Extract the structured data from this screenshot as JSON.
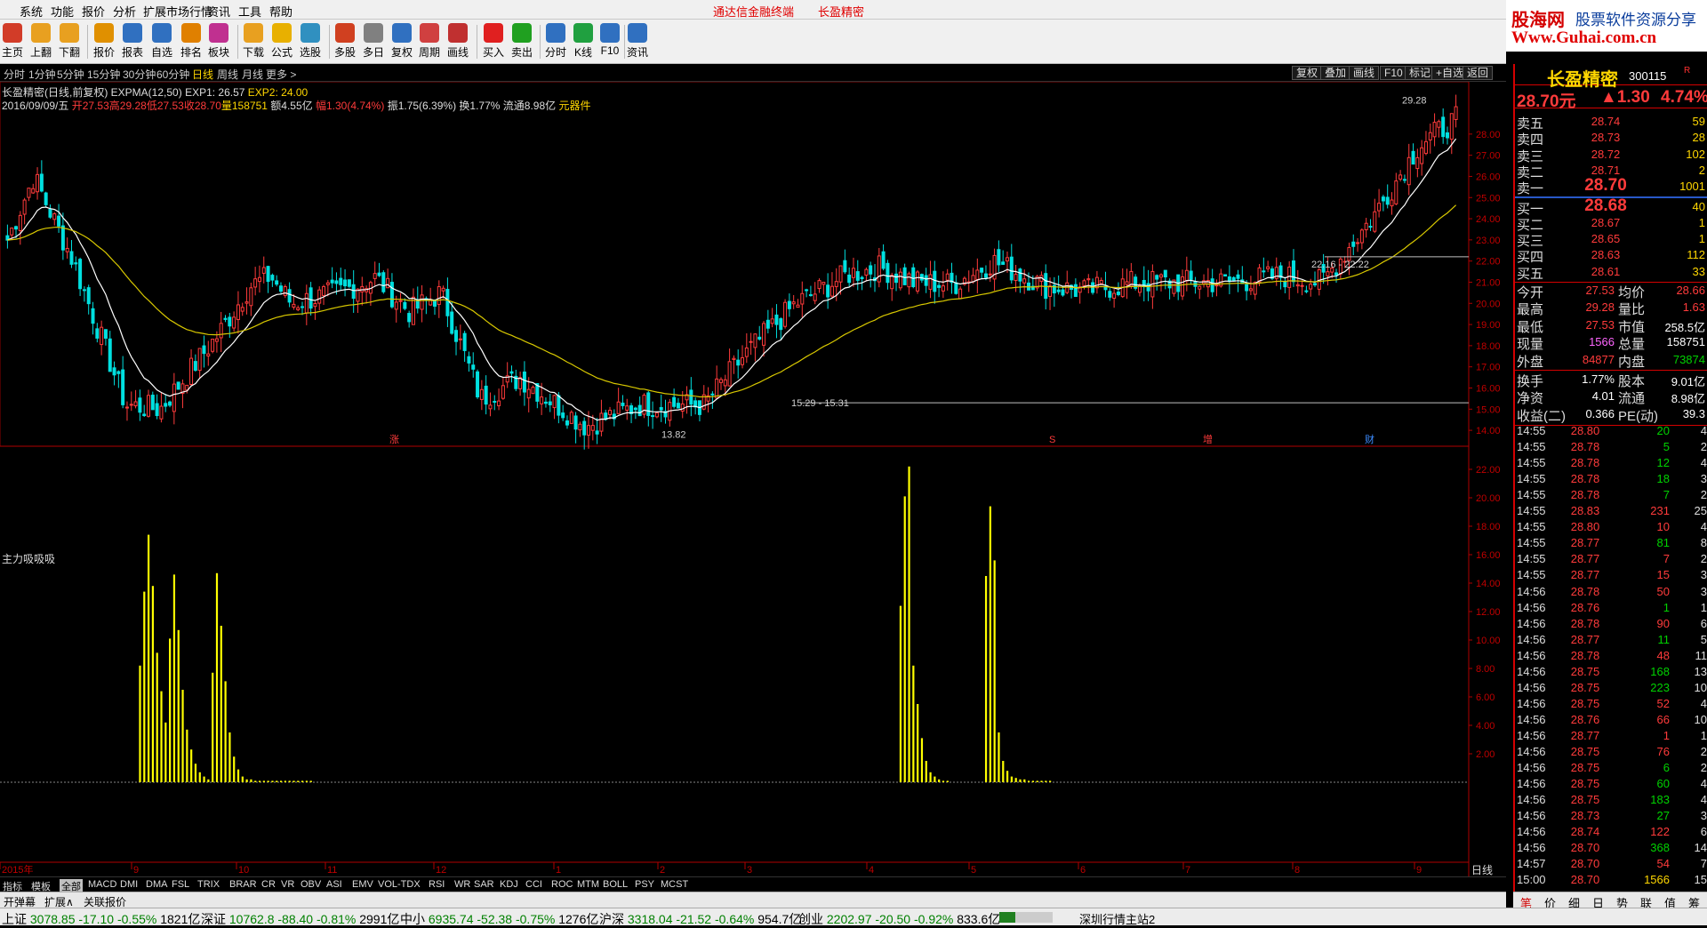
{
  "menu": {
    "items": [
      "系统",
      "功能",
      "报价",
      "分析",
      "扩展市场行情",
      "资讯",
      "工具",
      "帮助"
    ],
    "notice1": "通达信金融终端",
    "notice2": "长盈精密"
  },
  "logo": {
    "text1": "股海网",
    "text2": "股票软件资源分享",
    "text3": "Www.Guhai.com.cn"
  },
  "toolbar": [
    {
      "label": "主页",
      "icon": "home-icon",
      "color": "#d23c28"
    },
    {
      "label": "上翻",
      "icon": "up-arrow-icon",
      "color": "#e8a020"
    },
    {
      "label": "下翻",
      "icon": "down-arrow-icon",
      "color": "#e8a020"
    },
    {
      "label": "报价",
      "icon": "yen-icon",
      "color": "#e09000"
    },
    {
      "label": "报表",
      "icon": "report-icon",
      "color": "#3070c0"
    },
    {
      "label": "自选",
      "icon": "f6-icon",
      "color": "#3070c0"
    },
    {
      "label": "排名",
      "icon": "rank-icon",
      "color": "#e08000"
    },
    {
      "label": "板块",
      "icon": "sector-icon",
      "color": "#c03090"
    },
    {
      "label": "下载",
      "icon": "download-icon",
      "color": "#e8a020"
    },
    {
      "label": "公式",
      "icon": "formula-icon",
      "color": "#e8b000"
    },
    {
      "label": "选股",
      "icon": "select-icon",
      "color": "#3090c0"
    },
    {
      "label": "多股",
      "icon": "multi-stock-icon",
      "color": "#d04020"
    },
    {
      "label": "多日",
      "icon": "multi-day-icon",
      "color": "#808080"
    },
    {
      "label": "复权",
      "icon": "restore-icon",
      "color": "#3070c0"
    },
    {
      "label": "周期",
      "icon": "f8-icon",
      "color": "#d04040"
    },
    {
      "label": "画线",
      "icon": "draw-icon",
      "color": "#c03030"
    },
    {
      "label": "买入",
      "icon": "buy-icon",
      "color": "#e02020"
    },
    {
      "label": "卖出",
      "icon": "sell-icon",
      "color": "#20a020"
    },
    {
      "label": "分时",
      "icon": "intraday-icon",
      "color": "#3070c0"
    },
    {
      "label": "K线",
      "icon": "kline-icon",
      "color": "#20a040"
    },
    {
      "label": "F10",
      "icon": "f10-icon",
      "color": "#3070c0"
    },
    {
      "label": "资讯",
      "icon": "news-icon",
      "color": "#3070c0"
    }
  ],
  "periods": [
    "分时",
    "1分钟",
    "5分钟",
    "15分钟",
    "30分钟",
    "60分钟",
    "日线",
    "周线",
    "月线",
    "更多 >"
  ],
  "active_period": "日线",
  "right_buttons": [
    "复权",
    "叠加",
    "画线",
    "F10",
    "标记",
    "+自选",
    "返回"
  ],
  "info": {
    "name_line": "长盈精密(日线,前复权)",
    "expma_label": "EXPMA(12,50)",
    "exp1": "EXP1: 26.57",
    "exp2": "EXP2: 24.00",
    "date": "2016/09/09/五",
    "open": "开27.53",
    "high": "高29.28",
    "low": "低27.53",
    "close": "收28.70",
    "vol": "量158751",
    "amount": "额4.55亿",
    "rise": "幅1.30(4.74%)",
    "amp": "振1.75(6.39%)",
    "turnover": "换1.77%",
    "float": "流通8.98亿",
    "yuanqijian": "元器件"
  },
  "indicator": {
    "name": "主力吸吸吸"
  },
  "indicator_tabs": [
    "指标",
    "模板",
    "全部",
    "MACD",
    "DMI",
    "DMA",
    "FSL",
    "TRIX",
    "BRAR",
    "CR",
    "VR",
    "OBV",
    "ASI",
    "EMV",
    "VOL-TDX",
    "RSI",
    "WR",
    "SAR",
    "KDJ",
    "CCI",
    "ROC",
    "MTM",
    "BOLL",
    "PSY",
    "MCST"
  ],
  "bottom_tabs": [
    "开弹幕",
    "扩展∧",
    "关联报价"
  ],
  "day_label": "日线",
  "chart_data": [
    {
      "type": "candlestick",
      "title": "长盈精密(日线,前复权)",
      "ylim": [
        13.5,
        29.8
      ],
      "yticks": [
        "28.00",
        "27.00",
        "26.00",
        "25.00",
        "24.00",
        "23.00",
        "22.00",
        "21.00",
        "20.00",
        "19.00",
        "18.00",
        "17.00",
        "16.00",
        "15.00",
        "14.00"
      ],
      "xlabels": [
        "2015年",
        "9",
        "10",
        "11",
        "12",
        "1",
        "2",
        "3",
        "4",
        "5",
        "6",
        "7",
        "8",
        "9"
      ],
      "annotations": [
        "29.28",
        "13.82",
        "15.29 - 15.31",
        "22.16 - 22.22"
      ],
      "markers": [
        "涨",
        "S",
        "增",
        "财"
      ],
      "series": [
        {
          "name": "EXP1"
        },
        {
          "name": "EXP2"
        }
      ]
    },
    {
      "type": "bar",
      "title": "主力吸吸吸",
      "ylim": [
        0,
        22.5
      ],
      "yticks": [
        "22.00",
        "20.00",
        "18.00",
        "16.00",
        "14.00",
        "12.00",
        "10.00",
        "8.00",
        "6.00",
        "4.00",
        "2.00"
      ],
      "values": [
        0,
        0,
        0,
        0,
        0,
        0,
        0,
        0,
        0,
        0,
        0,
        0,
        0,
        0,
        0,
        0,
        0,
        0,
        0,
        0,
        0,
        0,
        0,
        0,
        0,
        0,
        0,
        0,
        0,
        0,
        0,
        8.2,
        13.4,
        17.4,
        13.8,
        9.1,
        6.4,
        4.2,
        10.1,
        14.6,
        10.7,
        6.5,
        3.7,
        2.3,
        1.3,
        0.7,
        0.4,
        0.2,
        7.7,
        14.7,
        11.0,
        7.1,
        3.5,
        1.8,
        0.9,
        0.4,
        0.2,
        0.2,
        0.1,
        0.1,
        0.1,
        0.1,
        0.1,
        0.1,
        0.1,
        0.1,
        0.1,
        0.1,
        0.1,
        0.1,
        0.1,
        0.1,
        0,
        0,
        0,
        0,
        0,
        0,
        0,
        0,
        0,
        0,
        0,
        0,
        0,
        0,
        0,
        0,
        0,
        0,
        0,
        0,
        0,
        0,
        0,
        0,
        0,
        0,
        0,
        0,
        0,
        0,
        0,
        0,
        0,
        0,
        0,
        0,
        0,
        0,
        0,
        0,
        0,
        0,
        0,
        0,
        0,
        0,
        0,
        0,
        0,
        0,
        0,
        0,
        0,
        0,
        0,
        0,
        0,
        0,
        0,
        0,
        0,
        0,
        0,
        0,
        0,
        0,
        0,
        0,
        0,
        0,
        0,
        0,
        0,
        0,
        0,
        0,
        0,
        0,
        0,
        0,
        0,
        0,
        0,
        0,
        0,
        0,
        0,
        0,
        0,
        0,
        0,
        0,
        0,
        0,
        0,
        0,
        0,
        0,
        0,
        0,
        0,
        0,
        0,
        0,
        0,
        0,
        0,
        0,
        0,
        0,
        0,
        0,
        0,
        0,
        0,
        0,
        0,
        0,
        0,
        0,
        0,
        0,
        0,
        0,
        0,
        0,
        0,
        0,
        0,
        0,
        0,
        0,
        0,
        0,
        0,
        0,
        0,
        12.4,
        20.1,
        22.2,
        8.2,
        5.5,
        3.1,
        1.5,
        0.7,
        0.4,
        0.2,
        0.1,
        0.1,
        0,
        0,
        0,
        0,
        0,
        0,
        0,
        0,
        14.5,
        19.4,
        15.6,
        3.5,
        1.5,
        0.8,
        0.4,
        0.3,
        0.2,
        0.2,
        0.1,
        0.1,
        0.1,
        0.1,
        0.1,
        0.1,
        0,
        0,
        0,
        0,
        0,
        0,
        0,
        0,
        0,
        0,
        0,
        0,
        0,
        0,
        0,
        0,
        0,
        0,
        0,
        0,
        0,
        0,
        0,
        0,
        0,
        0,
        0,
        0,
        0,
        0,
        0,
        0,
        0,
        0,
        0,
        0,
        0,
        0,
        0,
        0,
        0,
        0,
        0,
        0,
        0,
        0,
        0,
        0,
        0,
        0,
        0,
        0,
        0,
        0,
        0,
        0,
        0,
        0,
        0,
        0,
        0,
        0,
        0,
        0,
        0,
        0,
        0,
        0,
        0,
        0,
        0,
        0,
        0,
        0,
        0,
        0,
        0,
        0,
        0,
        0,
        0,
        0,
        0,
        0,
        0,
        0,
        0,
        0,
        0,
        0,
        0,
        0,
        0,
        0,
        0,
        0,
        0,
        0,
        0,
        0,
        0,
        0,
        0,
        0,
        0,
        0,
        0,
        0,
        0,
        0,
        0,
        0,
        0,
        0,
        0,
        0,
        0,
        0,
        0,
        0,
        0,
        0,
        0,
        0,
        0,
        0,
        0
      ]
    }
  ],
  "right_panel": {
    "name": "长盈精密",
    "code": "300115",
    "rmark": "R",
    "price": "28.70元",
    "change": "▲1.30",
    "pct": "4.74%",
    "asks": [
      {
        "label": "卖五",
        "price": "28.74",
        "vol": "59"
      },
      {
        "label": "卖四",
        "price": "28.73",
        "vol": "28"
      },
      {
        "label": "卖三",
        "price": "28.72",
        "vol": "102"
      },
      {
        "label": "卖二",
        "price": "28.71",
        "vol": "2"
      },
      {
        "label": "卖一",
        "price": "28.70",
        "vol": "1001"
      }
    ],
    "bids": [
      {
        "label": "买一",
        "price": "28.68",
        "vol": "40"
      },
      {
        "label": "买二",
        "price": "28.67",
        "vol": "1"
      },
      {
        "label": "买三",
        "price": "28.65",
        "vol": "1"
      },
      {
        "label": "买四",
        "price": "28.63",
        "vol": "112"
      },
      {
        "label": "买五",
        "price": "28.61",
        "vol": "33"
      }
    ],
    "stats": [
      {
        "l1": "今开",
        "v1": "27.53",
        "c1": "#ff3b3b",
        "l2": "均价",
        "v2": "28.66",
        "c2": "#ff3b3b"
      },
      {
        "l1": "最高",
        "v1": "29.28",
        "c1": "#ff3b3b",
        "l2": "量比",
        "v2": "1.63",
        "c2": "#ff3b3b"
      },
      {
        "l1": "最低",
        "v1": "27.53",
        "c1": "#ff3b3b",
        "l2": "市值",
        "v2": "258.5亿",
        "c2": "#ffffff"
      },
      {
        "l1": "现量",
        "v1": "1566",
        "c1": "#ff66ff",
        "l2": "总量",
        "v2": "158751",
        "c2": "#ffffff"
      },
      {
        "l1": "外盘",
        "v1": "84877",
        "c1": "#ff3b3b",
        "l2": "内盘",
        "v2": "73874",
        "c2": "#00d200"
      },
      {
        "l1": "换手",
        "v1": "1.77%",
        "c1": "#ffffff",
        "l2": "股本",
        "v2": "9.01亿",
        "c2": "#ffffff"
      },
      {
        "l1": "净资",
        "v1": "4.01",
        "c1": "#ffffff",
        "l2": "流通",
        "v2": "8.98亿",
        "c2": "#ffffff"
      },
      {
        "l1": "收益(二)",
        "v1": "0.366",
        "c1": "#ffffff",
        "l2": "PE(动)",
        "v2": "39.3",
        "c2": "#ffffff"
      }
    ],
    "ticks": [
      {
        "t": "14:55",
        "p": "28.80",
        "v": "20",
        "vc": "#00d200",
        "n": "4"
      },
      {
        "t": "14:55",
        "p": "28.78",
        "v": "5",
        "vc": "#00d200",
        "n": "2"
      },
      {
        "t": "14:55",
        "p": "28.78",
        "v": "12",
        "vc": "#00d200",
        "n": "4"
      },
      {
        "t": "14:55",
        "p": "28.78",
        "v": "18",
        "vc": "#00d200",
        "n": "3"
      },
      {
        "t": "14:55",
        "p": "28.78",
        "v": "7",
        "vc": "#00d200",
        "n": "2"
      },
      {
        "t": "14:55",
        "p": "28.83",
        "v": "231",
        "vc": "#ff3b3b",
        "n": "25"
      },
      {
        "t": "14:55",
        "p": "28.80",
        "v": "10",
        "vc": "#ff3b3b",
        "n": "4"
      },
      {
        "t": "14:55",
        "p": "28.77",
        "v": "81",
        "vc": "#00d200",
        "n": "8"
      },
      {
        "t": "14:55",
        "p": "28.77",
        "v": "7",
        "vc": "#ff3b3b",
        "n": "2"
      },
      {
        "t": "14:55",
        "p": "28.77",
        "v": "15",
        "vc": "#ff3b3b",
        "n": "3"
      },
      {
        "t": "14:56",
        "p": "28.78",
        "v": "50",
        "vc": "#ff3b3b",
        "n": "3"
      },
      {
        "t": "14:56",
        "p": "28.76",
        "v": "1",
        "vc": "#00d200",
        "n": "1"
      },
      {
        "t": "14:56",
        "p": "28.78",
        "v": "90",
        "vc": "#ff3b3b",
        "n": "6"
      },
      {
        "t": "14:56",
        "p": "28.77",
        "v": "11",
        "vc": "#00d200",
        "n": "5"
      },
      {
        "t": "14:56",
        "p": "28.78",
        "v": "48",
        "vc": "#ff3b3b",
        "n": "11"
      },
      {
        "t": "14:56",
        "p": "28.75",
        "v": "168",
        "vc": "#00d200",
        "n": "13"
      },
      {
        "t": "14:56",
        "p": "28.75",
        "v": "223",
        "vc": "#00d200",
        "n": "10"
      },
      {
        "t": "14:56",
        "p": "28.75",
        "v": "52",
        "vc": "#ff3b3b",
        "n": "4"
      },
      {
        "t": "14:56",
        "p": "28.76",
        "v": "66",
        "vc": "#ff3b3b",
        "n": "10"
      },
      {
        "t": "14:56",
        "p": "28.77",
        "v": "1",
        "vc": "#ff3b3b",
        "n": "1"
      },
      {
        "t": "14:56",
        "p": "28.75",
        "v": "76",
        "vc": "#ff3b3b",
        "n": "2"
      },
      {
        "t": "14:56",
        "p": "28.75",
        "v": "6",
        "vc": "#00d200",
        "n": "2"
      },
      {
        "t": "14:56",
        "p": "28.75",
        "v": "60",
        "vc": "#00d200",
        "n": "4"
      },
      {
        "t": "14:56",
        "p": "28.75",
        "v": "183",
        "vc": "#00d200",
        "n": "4"
      },
      {
        "t": "14:56",
        "p": "28.73",
        "v": "27",
        "vc": "#00d200",
        "n": "3"
      },
      {
        "t": "14:56",
        "p": "28.74",
        "v": "122",
        "vc": "#ff3b3b",
        "n": "6"
      },
      {
        "t": "14:56",
        "p": "28.70",
        "v": "368",
        "vc": "#00d200",
        "n": "14"
      },
      {
        "t": "14:57",
        "p": "28.70",
        "v": "54",
        "vc": "#ff3b3b",
        "n": "7"
      },
      {
        "t": "15:00",
        "p": "28.70",
        "v": "1566",
        "vc": "#ffd700",
        "n": "15"
      }
    ],
    "footer": [
      "笔",
      "价",
      "细",
      "日",
      "势",
      "联",
      "值",
      "筹"
    ]
  },
  "status": [
    {
      "name": "上证",
      "val": "3078.85",
      "chg": "-17.10",
      "pct": "-0.55%",
      "amt": "1821亿"
    },
    {
      "name": "深证",
      "val": "10762.8",
      "chg": "-88.40",
      "pct": "-0.81%",
      "amt": "2991亿"
    },
    {
      "name": "中小",
      "val": "6935.74",
      "chg": "-52.38",
      "pct": "-0.75%",
      "amt": "1276亿"
    },
    {
      "name": "沪深",
      "val": "3318.04",
      "chg": "-21.52",
      "pct": "-0.64%",
      "amt": "954.7亿"
    },
    {
      "name": "创业",
      "val": "2202.97",
      "chg": "-20.50",
      "pct": "-0.92%",
      "amt": "833.6亿"
    }
  ],
  "server": "深圳行情主站2",
  "colors": {
    "up": "#ff3b3b",
    "down": "#00e0e0",
    "exp1": "#ffffff",
    "exp2": "#d8c800",
    "bar": "#ffff00",
    "border": "#d40000"
  }
}
